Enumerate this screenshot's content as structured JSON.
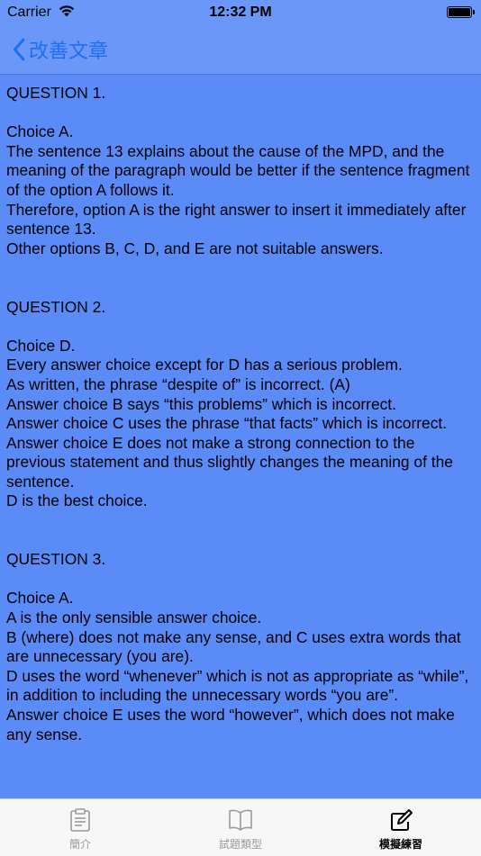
{
  "status_bar": {
    "carrier": "Carrier",
    "time": "12:32 PM"
  },
  "nav": {
    "back_label": "改善文章"
  },
  "questions": [
    {
      "title": "QUESTION 1.",
      "lines": [
        "Choice A.",
        "The sentence 13 explains about the cause of the MPD, and the meaning of the paragraph would be better if the sentence fragment of the option A follows it.",
        "Therefore, option A is the right answer to insert it immediately after sentence 13.",
        "Other options B, C, D, and E are not suitable answers."
      ]
    },
    {
      "title": "QUESTION 2.",
      "lines": [
        "Choice D.",
        "Every answer choice except for D has a serious problem.",
        "As written, the phrase “despite of” is incorrect. (A)",
        "Answer choice B says “this problems” which is incorrect.",
        "Answer choice C uses the phrase “that facts” which is incorrect.",
        "Answer choice E does not make a strong connection to the previous statement and thus slightly changes the meaning of the sentence.",
        "D is the best choice."
      ]
    },
    {
      "title": "QUESTION 3.",
      "lines": [
        "Choice A.",
        "A is the only sensible answer choice.",
        "B (where) does not make any sense, and C uses extra words that are unnecessary (you are).",
        "D uses the word “whenever” which is not as appropriate as “while”, in addition to including the unnecessary words “you are”.",
        "Answer choice E uses the word “however”, which does not make any sense."
      ]
    }
  ],
  "tabs": [
    {
      "label": "簡介",
      "icon": "clipboard-icon",
      "active": false
    },
    {
      "label": "試題類型",
      "icon": "open-book-icon",
      "active": false
    },
    {
      "label": "模擬練習",
      "icon": "edit-icon",
      "active": true
    }
  ],
  "colors": {
    "background": "#5b8bf7",
    "bar": "#6a97f8",
    "accent": "#1d6ff2",
    "tab_bar": "#f7f7f7"
  }
}
